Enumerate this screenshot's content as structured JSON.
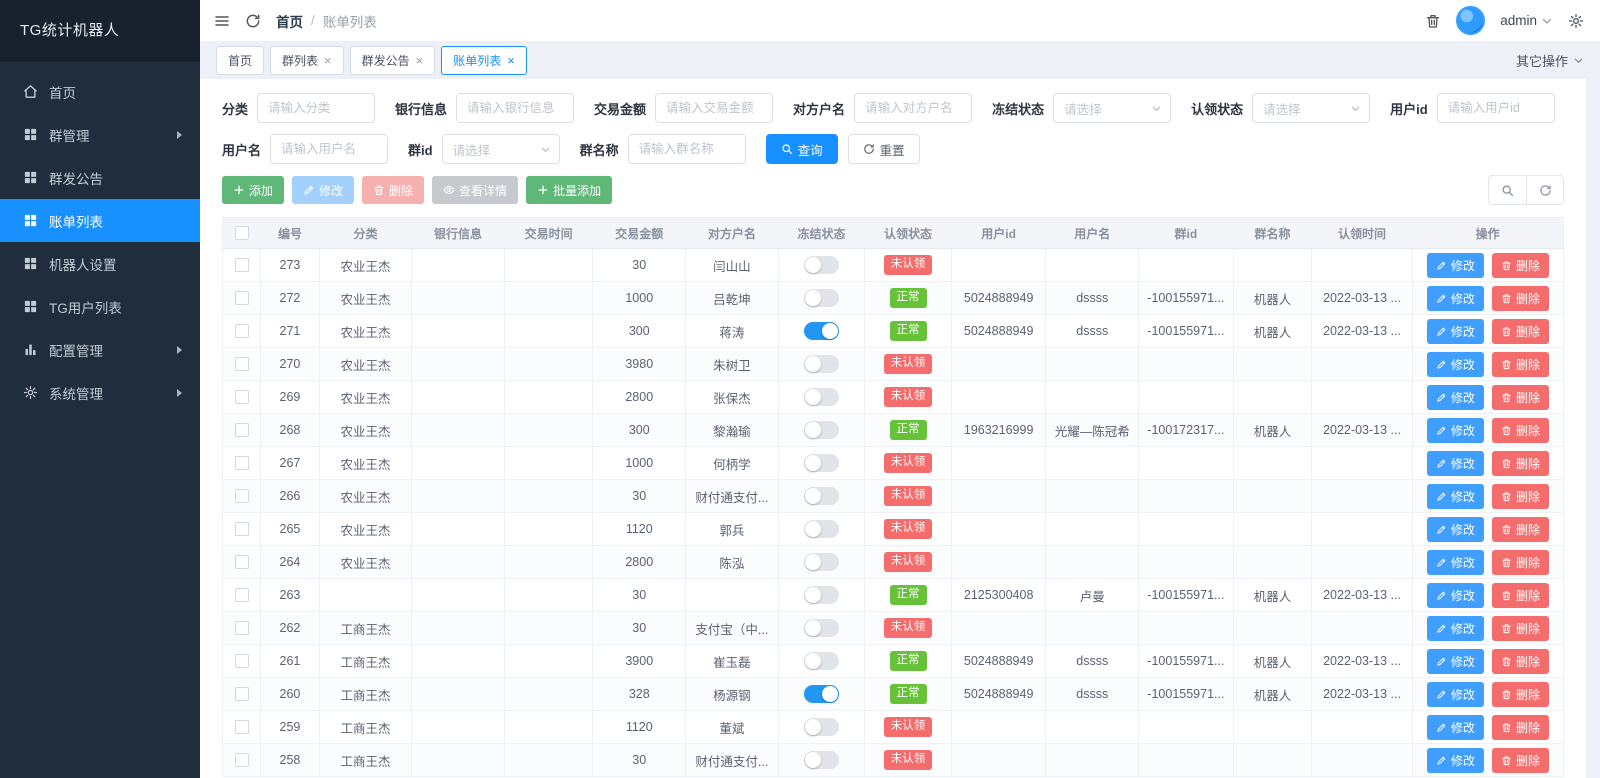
{
  "colors": {
    "accent": "#1890ff",
    "sidebar_bg": "#1f2d3c",
    "green": "#5fb878",
    "red": "#f56c6c",
    "blue": "#409eff",
    "badge_green": "#67c23a",
    "toggle_on": "#2196f3"
  },
  "sidebar": {
    "logo": "TG统计机器人",
    "items": [
      {
        "id": "home",
        "label": "首页",
        "icon": "home",
        "arrow": false,
        "active": false
      },
      {
        "id": "group-manage",
        "label": "群管理",
        "icon": "grid",
        "arrow": true,
        "active": false
      },
      {
        "id": "group-announce",
        "label": "群发公告",
        "icon": "grid",
        "arrow": false,
        "active": false
      },
      {
        "id": "bill-list",
        "label": "账单列表",
        "icon": "grid",
        "arrow": false,
        "active": true
      },
      {
        "id": "robot-settings",
        "label": "机器人设置",
        "icon": "grid",
        "arrow": false,
        "active": false
      },
      {
        "id": "tg-user-list",
        "label": "TG用户列表",
        "icon": "grid",
        "arrow": false,
        "active": false
      },
      {
        "id": "config-manage",
        "label": "配置管理",
        "icon": "chart",
        "arrow": true,
        "active": false
      },
      {
        "id": "system-manage",
        "label": "系统管理",
        "icon": "gear",
        "arrow": true,
        "active": false
      }
    ]
  },
  "topbar": {
    "breadcrumb_root": "首页",
    "breadcrumb_separator": "/",
    "breadcrumb_current": "账单列表",
    "username": "admin"
  },
  "tabs": {
    "items": [
      {
        "id": "home",
        "label": "首页",
        "closable": false,
        "active": false
      },
      {
        "id": "group-list",
        "label": "群列表",
        "closable": true,
        "active": false
      },
      {
        "id": "group-announce",
        "label": "群发公告",
        "closable": true,
        "active": false
      },
      {
        "id": "bill-list",
        "label": "账单列表",
        "closable": true,
        "active": true
      }
    ],
    "other_label": "其它操作"
  },
  "filters": {
    "row1": [
      {
        "id": "category",
        "label": "分类",
        "placeholder": "请输入分类",
        "type": "input"
      },
      {
        "id": "bank-info",
        "label": "银行信息",
        "placeholder": "请输入银行信息",
        "type": "input"
      },
      {
        "id": "amount",
        "label": "交易金额",
        "placeholder": "请输入交易金额",
        "type": "input"
      },
      {
        "id": "counterparty",
        "label": "对方户名",
        "placeholder": "请输入对方户名",
        "type": "input"
      },
      {
        "id": "frozen-status",
        "label": "冻结状态",
        "placeholder": "请选择",
        "type": "select"
      },
      {
        "id": "claim-status",
        "label": "认领状态",
        "placeholder": "请选择",
        "type": "select"
      },
      {
        "id": "user-id",
        "label": "用户id",
        "placeholder": "请输入用户id",
        "type": "input"
      }
    ],
    "row2": [
      {
        "id": "user-name",
        "label": "用户名",
        "placeholder": "请输入用户名",
        "type": "input"
      },
      {
        "id": "group-id",
        "label": "群id",
        "placeholder": "请选择",
        "type": "select"
      },
      {
        "id": "group-name",
        "label": "群名称",
        "placeholder": "请输入群名称",
        "type": "input"
      }
    ],
    "query_label": "查询",
    "reset_label": "重置"
  },
  "toolbar": {
    "buttons": [
      {
        "id": "add",
        "label": "添加",
        "icon": "plus",
        "variant": "green",
        "disabled": false
      },
      {
        "id": "edit",
        "label": "修改",
        "icon": "edit",
        "variant": "blue",
        "disabled": true
      },
      {
        "id": "delete",
        "label": "删除",
        "icon": "trash",
        "variant": "red",
        "disabled": true
      },
      {
        "id": "view-detail",
        "label": "查看详情",
        "icon": "eye",
        "variant": "gray",
        "disabled": true
      },
      {
        "id": "batch-add",
        "label": "批量添加",
        "icon": "plus",
        "variant": "green",
        "disabled": false
      }
    ]
  },
  "table": {
    "headers": [
      "编号",
      "分类",
      "银行信息",
      "交易时间",
      "交易金额",
      "对方户名",
      "冻结状态",
      "认领状态",
      "用户id",
      "用户名",
      "群id",
      "群名称",
      "认领时间",
      "操作"
    ],
    "row_actions": {
      "edit": "修改",
      "delete": "删除"
    },
    "status_styles": {
      "未认领": "red",
      "正常": "green"
    },
    "rows": [
      {
        "id": "273",
        "category": "农业王杰",
        "bank": "",
        "time": "",
        "amount": "30",
        "name": "闫山山",
        "frozen": false,
        "status": "未认领",
        "uid": "",
        "uname": "",
        "gid": "",
        "gname": "",
        "claim_time": ""
      },
      {
        "id": "272",
        "category": "农业王杰",
        "bank": "",
        "time": "",
        "amount": "1000",
        "name": "吕乾坤",
        "frozen": false,
        "status": "正常",
        "uid": "5024888949",
        "uname": "dssss",
        "gid": "-100155971...",
        "gname": "机器人",
        "claim_time": "2022-03-13 ..."
      },
      {
        "id": "271",
        "category": "农业王杰",
        "bank": "",
        "time": "",
        "amount": "300",
        "name": "蒋涛",
        "frozen": true,
        "status": "正常",
        "uid": "5024888949",
        "uname": "dssss",
        "gid": "-100155971...",
        "gname": "机器人",
        "claim_time": "2022-03-13 ..."
      },
      {
        "id": "270",
        "category": "农业王杰",
        "bank": "",
        "time": "",
        "amount": "3980",
        "name": "朱树卫",
        "frozen": false,
        "status": "未认领",
        "uid": "",
        "uname": "",
        "gid": "",
        "gname": "",
        "claim_time": ""
      },
      {
        "id": "269",
        "category": "农业王杰",
        "bank": "",
        "time": "",
        "amount": "2800",
        "name": "张保杰",
        "frozen": false,
        "status": "未认领",
        "uid": "",
        "uname": "",
        "gid": "",
        "gname": "",
        "claim_time": ""
      },
      {
        "id": "268",
        "category": "农业王杰",
        "bank": "",
        "time": "",
        "amount": "300",
        "name": "黎瀚瑜",
        "frozen": false,
        "status": "正常",
        "uid": "1963216999",
        "uname": "光耀—陈冠希",
        "gid": "-100172317...",
        "gname": "机器人",
        "claim_time": "2022-03-13 ..."
      },
      {
        "id": "267",
        "category": "农业王杰",
        "bank": "",
        "time": "",
        "amount": "1000",
        "name": "何柄学",
        "frozen": false,
        "status": "未认领",
        "uid": "",
        "uname": "",
        "gid": "",
        "gname": "",
        "claim_time": ""
      },
      {
        "id": "266",
        "category": "农业王杰",
        "bank": "",
        "time": "",
        "amount": "30",
        "name": "财付通支付...",
        "frozen": false,
        "status": "未认领",
        "uid": "",
        "uname": "",
        "gid": "",
        "gname": "",
        "claim_time": ""
      },
      {
        "id": "265",
        "category": "农业王杰",
        "bank": "",
        "time": "",
        "amount": "1120",
        "name": "郭兵",
        "frozen": false,
        "status": "未认领",
        "uid": "",
        "uname": "",
        "gid": "",
        "gname": "",
        "claim_time": ""
      },
      {
        "id": "264",
        "category": "农业王杰",
        "bank": "",
        "time": "",
        "amount": "2800",
        "name": "陈泓",
        "frozen": false,
        "status": "未认领",
        "uid": "",
        "uname": "",
        "gid": "",
        "gname": "",
        "claim_time": ""
      },
      {
        "id": "263",
        "category": "",
        "bank": "",
        "time": "",
        "amount": "30",
        "name": "",
        "frozen": false,
        "status": "正常",
        "uid": "2125300408",
        "uname": "卢曼",
        "gid": "-100155971...",
        "gname": "机器人",
        "claim_time": "2022-03-13 ..."
      },
      {
        "id": "262",
        "category": "工商王杰",
        "bank": "",
        "time": "",
        "amount": "30",
        "name": "支付宝（中...",
        "frozen": false,
        "status": "未认领",
        "uid": "",
        "uname": "",
        "gid": "",
        "gname": "",
        "claim_time": ""
      },
      {
        "id": "261",
        "category": "工商王杰",
        "bank": "",
        "time": "",
        "amount": "3900",
        "name": "崔玉磊",
        "frozen": false,
        "status": "正常",
        "uid": "5024888949",
        "uname": "dssss",
        "gid": "-100155971...",
        "gname": "机器人",
        "claim_time": "2022-03-13 ..."
      },
      {
        "id": "260",
        "category": "工商王杰",
        "bank": "",
        "time": "",
        "amount": "328",
        "name": "杨源钢",
        "frozen": true,
        "status": "正常",
        "uid": "5024888949",
        "uname": "dssss",
        "gid": "-100155971...",
        "gname": "机器人",
        "claim_time": "2022-03-13 ..."
      },
      {
        "id": "259",
        "category": "工商王杰",
        "bank": "",
        "time": "",
        "amount": "1120",
        "name": "董斌",
        "frozen": false,
        "status": "未认领",
        "uid": "",
        "uname": "",
        "gid": "",
        "gname": "",
        "claim_time": ""
      },
      {
        "id": "258",
        "category": "工商王杰",
        "bank": "",
        "time": "",
        "amount": "30",
        "name": "财付通支付...",
        "frozen": false,
        "status": "未认领",
        "uid": "",
        "uname": "",
        "gid": "",
        "gname": "",
        "claim_time": ""
      }
    ]
  }
}
